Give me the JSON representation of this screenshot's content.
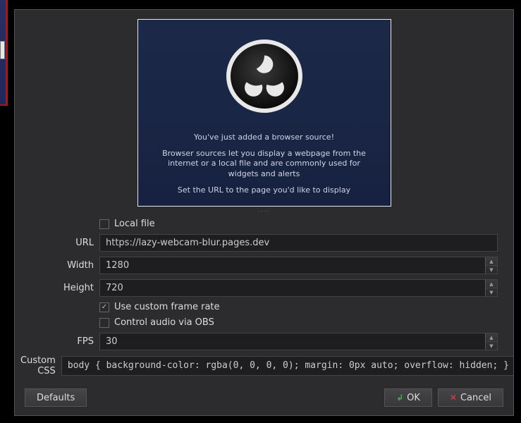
{
  "preview": {
    "line1": "You've just added a browser source!",
    "line2": "Browser sources let you display a webpage from the internet or a local file and are commonly used for widgets and alerts",
    "line3": "Set the URL to the page you'd like to display"
  },
  "form": {
    "local_file_label": "Local file",
    "local_file_checked": false,
    "url_label": "URL",
    "url_value": "https://lazy-webcam-blur.pages.dev",
    "width_label": "Width",
    "width_value": "1280",
    "height_label": "Height",
    "height_value": "720",
    "custom_fps_label": "Use custom frame rate",
    "custom_fps_checked": true,
    "control_audio_label": "Control audio via OBS",
    "control_audio_checked": false,
    "fps_label": "FPS",
    "fps_value": "30",
    "custom_css_label": "Custom CSS",
    "custom_css_value": "body { background-color: rgba(0, 0, 0, 0); margin: 0px auto; overflow: hidden; }"
  },
  "buttons": {
    "defaults": "Defaults",
    "ok": "OK",
    "cancel": "Cancel"
  }
}
